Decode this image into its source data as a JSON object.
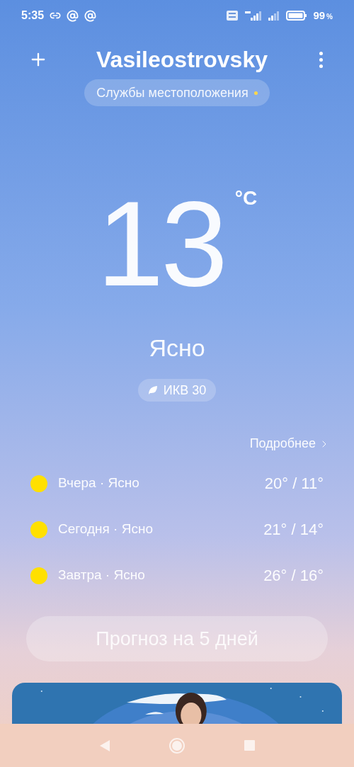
{
  "status_bar": {
    "time": "5:35",
    "battery": "99",
    "battery_unit": "%"
  },
  "header": {
    "city": "Vasileostrovsky",
    "location_chip": {
      "label": "Службы местоположения",
      "indicator_on": true
    }
  },
  "current": {
    "temperature": "13",
    "unit": "°C",
    "condition": "Ясно",
    "aqi": "ИКВ 30"
  },
  "daily": {
    "more_link": "Подробнее",
    "days": [
      {
        "summary": "Вчера · Ясно",
        "temps": "20° / 11°"
      },
      {
        "summary": "Сегодня · Ясно",
        "temps": "21° / 14°"
      },
      {
        "summary": "Завтра · Ясно",
        "temps": "26° / 16°"
      }
    ]
  },
  "forecast_button": "Прогноз на 5 дней"
}
